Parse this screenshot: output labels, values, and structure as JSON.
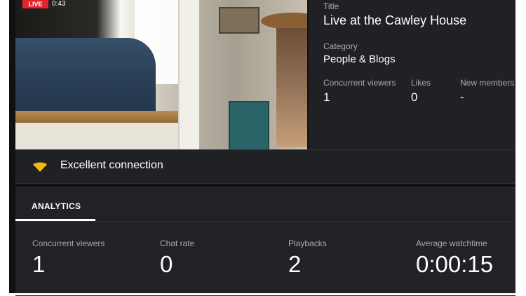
{
  "video": {
    "live_label": "LIVE",
    "timer": "0:43"
  },
  "details": {
    "title_label": "Title",
    "title_value": "Live at the Cawley House",
    "category_label": "Category",
    "category_value": "People & Blogs",
    "stats": [
      {
        "label": "Concurrent viewers",
        "value": "1"
      },
      {
        "label": "Likes",
        "value": "0"
      },
      {
        "label": "New members",
        "value": "-"
      }
    ]
  },
  "connection": {
    "icon": "wifi-icon",
    "text": "Excellent connection",
    "color": "#f3b712"
  },
  "analytics": {
    "tab_label": "ANALYTICS",
    "metrics": [
      {
        "label": "Concurrent viewers",
        "value": "1"
      },
      {
        "label": "Chat rate",
        "value": "0"
      },
      {
        "label": "Playbacks",
        "value": "2"
      },
      {
        "label": "Average watchtime",
        "value": "0:00:15"
      }
    ]
  }
}
